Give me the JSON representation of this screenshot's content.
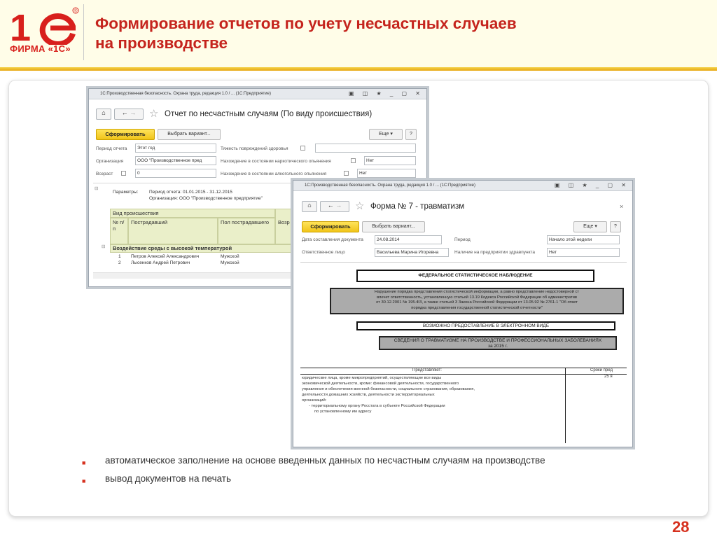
{
  "header": {
    "logo_text": "1С",
    "logo_caption": "ФИРМА «1С»",
    "title_line1": "Формирование отчетов по учету несчастных случаев",
    "title_line2": "на производстве"
  },
  "window1": {
    "titlebar": "1С:Производственная безопасность. Охрана труда, редакция 1.0 / ... (1С:Предприятие)",
    "form_title": "Отчет по несчастным случаям (По виду происшествия)",
    "btn_generate": "Сформировать",
    "btn_variant": "Выбрать вариант...",
    "btn_more": "Еще",
    "btn_help": "?",
    "fields": {
      "period_label": "Период отчета",
      "period_value": "Этот год",
      "severity_label": "Тяжесть повреждений здоровья",
      "org_label": "Организация",
      "org_value": "ООО \"Производственное пред",
      "drug_label": "Нахождение в состоянии наркотического опьянения",
      "drug_value": "Нет",
      "age_label": "Возраст",
      "age_value": "0",
      "alco_label": "Нахождение в состоянии алкогольного опьянения",
      "alco_value": "Нет"
    },
    "report": {
      "params_label": "Параметры:",
      "params_period": "Период отчета: 01.01.2015 - 31.12.2015",
      "params_org": "Организация: ООО \"Производственное предприятие\"",
      "group_header": "Вид происшествия",
      "columns": [
        "№ п/п",
        "Пострадавший",
        "Пол пострадавшего",
        "Возр"
      ],
      "group_row": "Воздействие среды с высокой температурой",
      "rows": [
        {
          "num": "1",
          "name": "Петров Алексей Александрович",
          "sex": "Мужской"
        },
        {
          "num": "2",
          "name": "Лысенков Андрей Петрович",
          "sex": "Мужской"
        }
      ]
    }
  },
  "window2": {
    "titlebar": "1С:Производственная безопасность. Охрана труда, редакция 1.0 / ... (1С:Предприятие)",
    "form_title": "Форма № 7 - травматизм",
    "btn_generate": "Сформировать",
    "btn_variant": "Выбрать вариант...",
    "btn_more": "Еще",
    "btn_help": "?",
    "fields": {
      "date_label": "Дата составления документа",
      "date_value": "24.08.2014",
      "period_label": "Период",
      "period_value": "Начало этой недели",
      "resp_label": "Ответственное лицо",
      "resp_value": "Васильева Марина Игоревна",
      "health_label": "Наличие на предприятии здравпункта",
      "health_value": "Нет"
    },
    "doc": {
      "box1": "ФЕДЕРАЛЬНОЕ СТАТИСТИЧЕСКОЕ НАБЛЮДЕНИЕ",
      "gray1_lines": [
        "Нарушение порядка представления статистической информации, а равно представление недостоверной ст",
        "влечет ответственность, установленную статьей 13.19 Кодекса Российской Федерации об административ",
        "от 30.12.2001 № 195-ФЗ, а также статьей 3 Закона Российской Федерации от 13.05.92 № 2761-1 \"Об ответ",
        "порядка представления государственной статистической отчетности\""
      ],
      "box2": "ВОЗМОЖНО ПРЕДОСТАВЛЕНИЕ В ЭЛЕКТРОННОМ ВИДЕ",
      "gray2_line1": "СВЕДЕНИЯ О ТРАВМАТИЗМЕ НА ПРОИЗВОДСТВЕ И ПРОФЕССИОНАЛЬНЫХ ЗАБОЛЕВАНИЯХ",
      "gray2_line2": "за 2015 г.",
      "col_present": "Представляют:",
      "col_terms": "Сроки пред",
      "col_terms_value": "25 я",
      "body_lines": [
        "юридические лица, кроме микропредприятий, осуществляющие все виды",
        "экономической деятельности, кроме: финансовой деятельности, государственного",
        "управления и обеспечения военной безопасности, социального страхования, образования,",
        "деятельности домашних хозяйств, деятельности экстерриториальных",
        "организаций:",
        "- территориальному органу Росстата в субъекте Российской Федерации",
        "по установленному им адресу"
      ]
    }
  },
  "bullets": [
    "автоматическое заполнение на основе введенных данных по несчастным случаям на производстве",
    "вывод документов на печать"
  ],
  "slide_number": "28",
  "colors": {
    "accent_red": "#c5241d",
    "header_gold": "#f0c419",
    "report_green": "#eaefc9"
  }
}
